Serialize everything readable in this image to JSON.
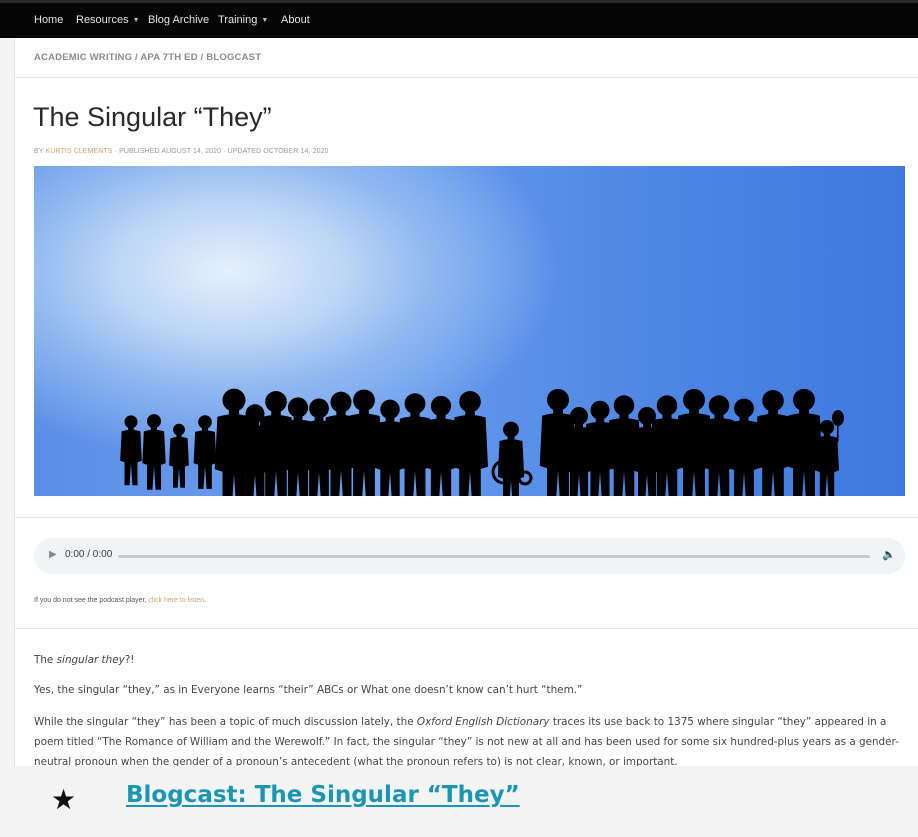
{
  "nav": {
    "items": [
      {
        "label": "Home",
        "dropdown": false
      },
      {
        "label": "Resources",
        "dropdown": true
      },
      {
        "label": "Blog Archive",
        "dropdown": false
      },
      {
        "label": "Training",
        "dropdown": true
      },
      {
        "label": "About",
        "dropdown": false
      }
    ],
    "caret_icon": "chevron-down-icon"
  },
  "breadcrumb": "ACADEMIC WRITING / APA 7TH ED / BLOGCAST",
  "post": {
    "title": "The Singular “They”",
    "byline_prefix": "BY ",
    "author": "KURTIS CLEMENTS",
    "published": " · PUBLISHED AUGUST 14, 2020 · UPDATED OCTOBER 14, 2020"
  },
  "player": {
    "time": "0:00 / 0:00",
    "progress": 0,
    "play_icon": "play-icon",
    "volume_icon": "volume-icon"
  },
  "podcast_note": {
    "text": "If you do not see the podcast player, ",
    "link": "click here to listen",
    "suffix": "."
  },
  "body": {
    "p1_prefix": "The ",
    "p1_emph": "singular they",
    "p1_suffix": "?!",
    "p2": "Yes, the singular “they,” as in Everyone learns “their” ABCs or What one doesn’t know can’t hurt “them.”",
    "p3_prefix": "While the singular “they” has been a topic of much discussion lately, the ",
    "p3_emph": "Oxford English Dictionary",
    "p3_suffix": " traces its use back to 1375 where singular “they” appeared in a poem titled “The Romance of William and the Werewolf.” In fact, the singular “they” is not new at all and has been used for some six hundred-plus years as a gender-neutral pronoun when the gender of a pronoun’s antecedent (what the pronoun refers to) is not clear, known, or important."
  },
  "footer": {
    "star_icon": "star-icon",
    "link": "Blogcast: The Singular “They”"
  },
  "colors": {
    "nav_bg": "#050505",
    "accent_gold": "#caa86a",
    "link_teal": "#1a96b4",
    "hero_blue": "#4f87e4"
  }
}
